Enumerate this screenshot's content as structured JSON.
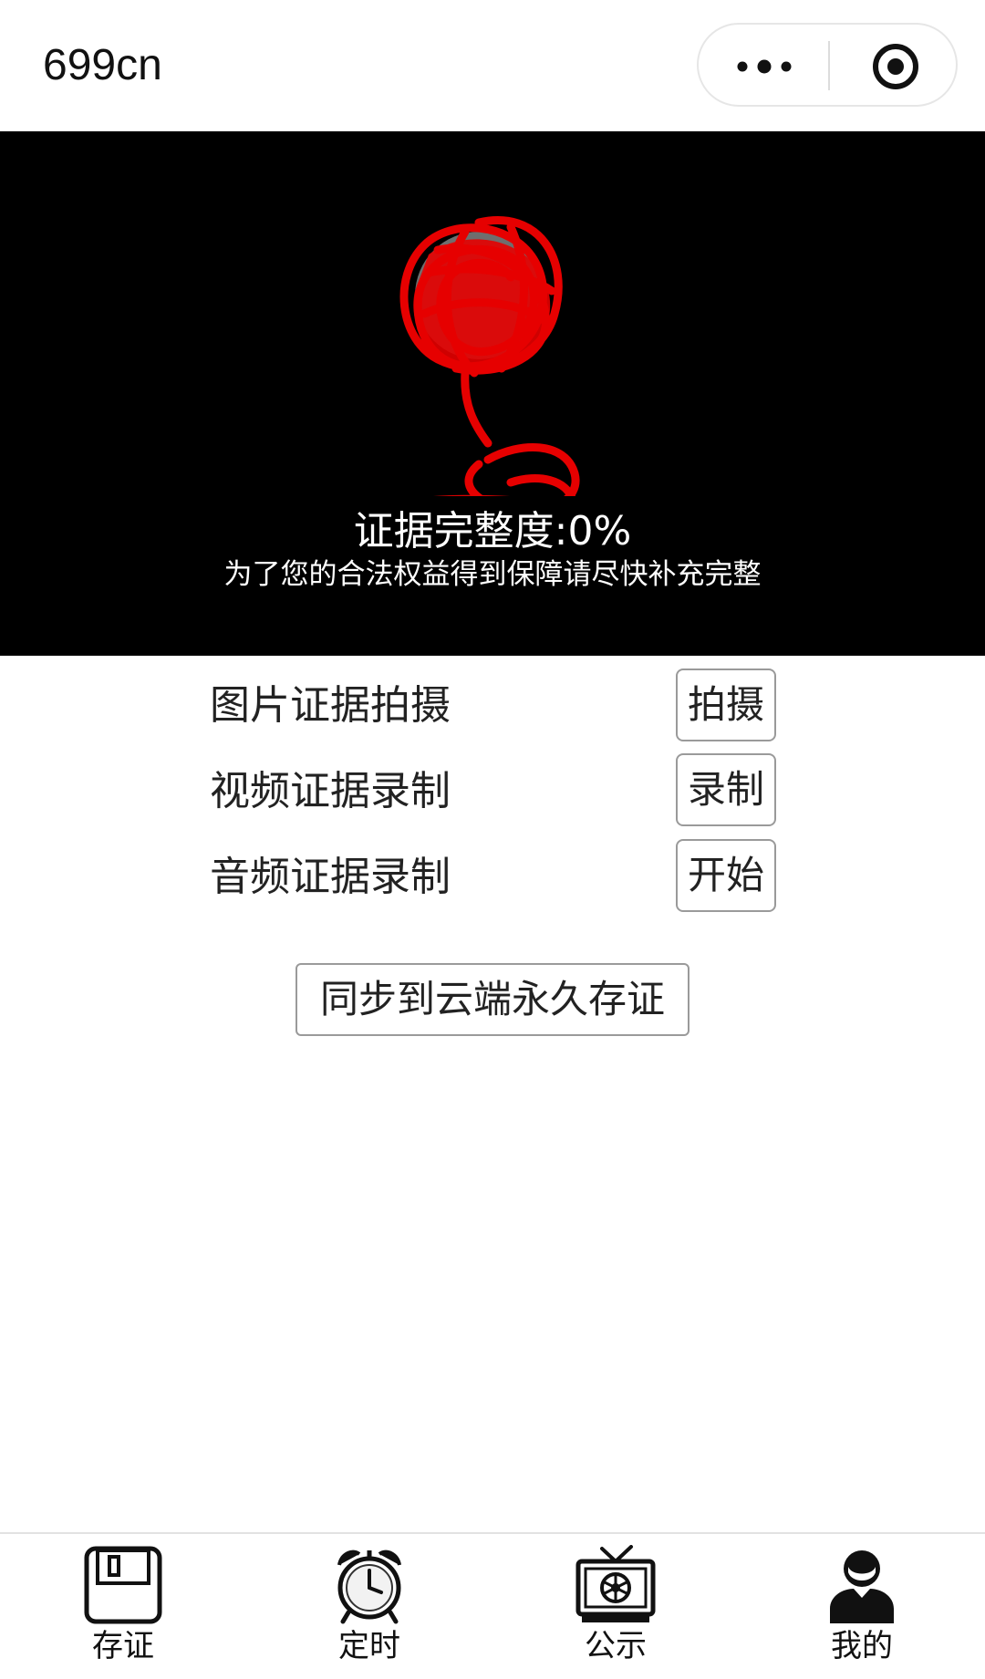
{
  "header": {
    "title": "699cn",
    "more_icon": "more-dots-icon",
    "close_icon": "target-close-icon"
  },
  "banner": {
    "integrity_text": "证据完整度:0%",
    "tip_text": "为了您的合法权益得到保障请尽快补充完整"
  },
  "evidence": {
    "photo": {
      "label": "图片证据拍摄",
      "button": "拍摄"
    },
    "video": {
      "label": "视频证据录制",
      "button": "录制"
    },
    "audio": {
      "label": "音频证据录制",
      "button": "开始"
    }
  },
  "sync_button": "同步到云端永久存证",
  "tabbar": {
    "items": [
      {
        "label": "存证",
        "icon": "save-evidence-icon"
      },
      {
        "label": "定时",
        "icon": "alarm-clock-icon"
      },
      {
        "label": "公示",
        "icon": "tv-icon"
      },
      {
        "label": "我的",
        "icon": "user-profile-icon"
      }
    ]
  },
  "colors": {
    "banner_bg": "#000000",
    "scribble": "#e60000",
    "border": "#9a9a9a"
  }
}
